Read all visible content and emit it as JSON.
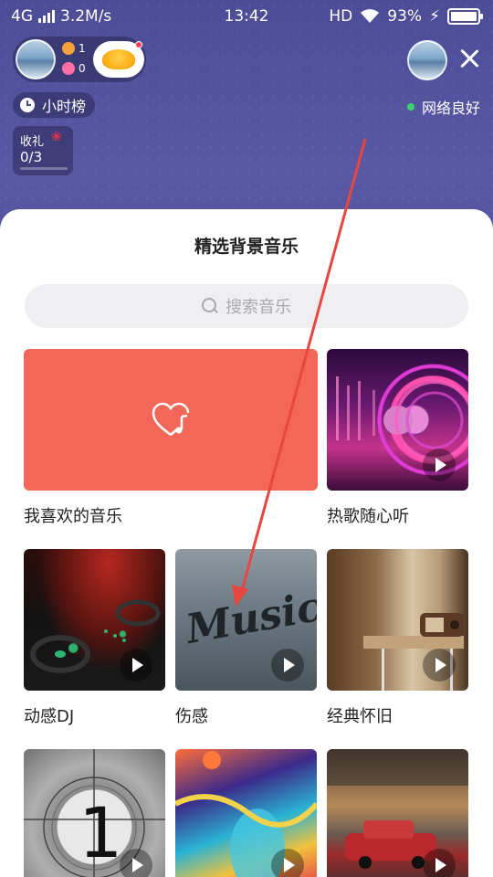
{
  "status_bar": {
    "network": "4G",
    "speed": "3.2M/s",
    "time": "13:42",
    "hd": "HD",
    "battery": "93%"
  },
  "room": {
    "host_followers": "1",
    "host_likes": "0",
    "rank_label": "小时榜",
    "network_status": "网络良好",
    "gift_label": "收礼",
    "gift_value": "0/3"
  },
  "sheet": {
    "title": "精选背景音乐",
    "search_placeholder": "搜索音乐"
  },
  "music_cards": [
    {
      "label": "我喜欢的音乐"
    },
    {
      "label": "热歌随心听"
    },
    {
      "label": "动感DJ"
    },
    {
      "label": "伤感"
    },
    {
      "label": "经典怀旧"
    }
  ],
  "overlay_texts": {
    "sad_card_text": "Music"
  },
  "colors": {
    "background": "#4a4a93",
    "favorite_card": "#f26757",
    "annotation_arrow": "#e8463f",
    "network_ok": "#3ad36b"
  },
  "icons": {
    "favorite": "heart-music-icon",
    "play": "play-icon",
    "close": "close-icon",
    "search": "search-icon",
    "rank": "clock-icon",
    "gift": "rose-icon"
  }
}
